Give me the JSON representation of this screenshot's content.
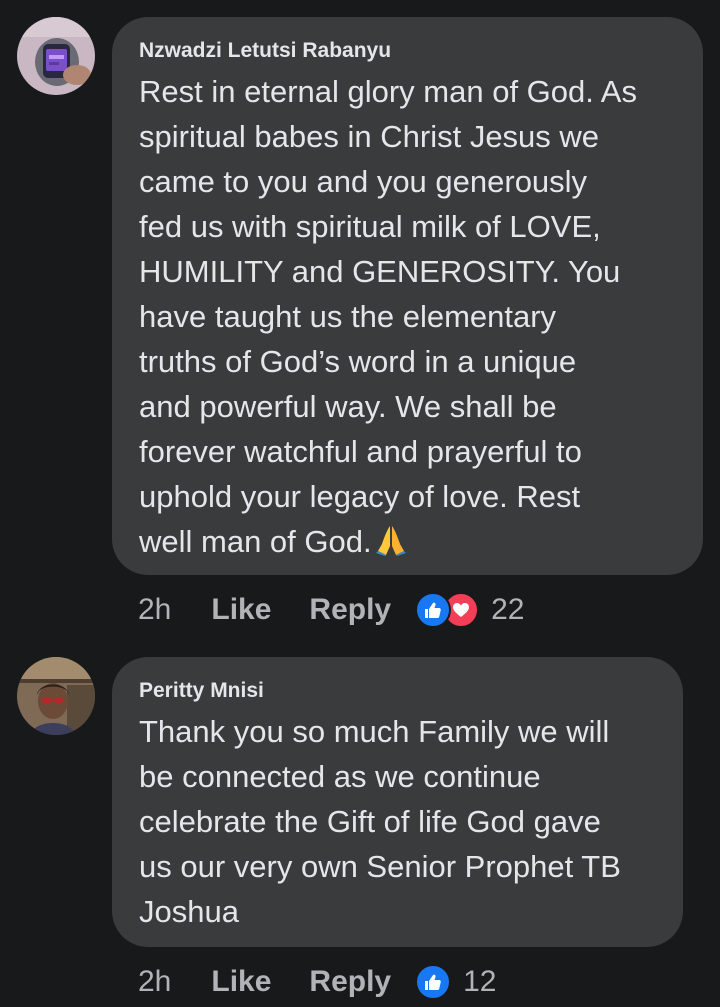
{
  "comments": [
    {
      "author": "Nzwadzi Letutsi Rabanyu",
      "text": "Rest in eternal glory man of God. As\nspiritual babes in Christ Jesus we\ncame to you and you generously\nfed us with spiritual milk of LOVE,\nHUMILITY and GENEROSITY. You\nhave taught us the elementary\ntruths of God’s word in a unique\nand powerful way. We shall be\nforever watchful and prayerful to\nuphold your legacy of love. Rest\nwell man of God.",
      "emoji": "folded-hands-emoji",
      "time": "2h",
      "like_label": "Like",
      "reply_label": "Reply",
      "reactions": [
        "like",
        "love"
      ],
      "reaction_count": "22"
    },
    {
      "author": "Peritty Mnisi",
      "text": "Thank you so much Family we will\nbe connected as we continue\ncelebrate the Gift of life God gave\nus our very own Senior Prophet TB\nJoshua",
      "time": "2h",
      "like_label": "Like",
      "reply_label": "Reply",
      "reactions": [
        "like"
      ],
      "reaction_count": "12"
    }
  ],
  "colors": {
    "background": "#18191a",
    "bubble": "#3a3b3c",
    "text": "#e4e6eb",
    "secondary_text": "#b0b3b8",
    "like_blue": "#1877f2",
    "love_red": "#f33e58"
  }
}
